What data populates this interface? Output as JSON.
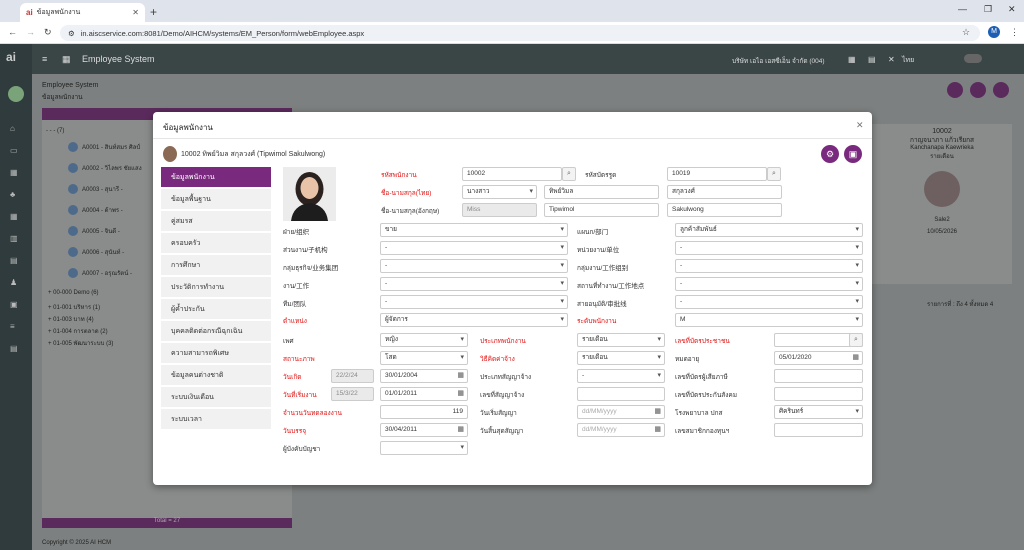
{
  "browser": {
    "tab_title": "ข้อมูลพนักงาน",
    "url": "in.aiscservice.com:8081/Demo/AIHCM/systems/EM_Person/form/webEmployee.aspx",
    "profile_initial": "M"
  },
  "app": {
    "title": "Employee System",
    "breadcrumb_top": "Employee System",
    "breadcrumb_sub": "ข้อมูลพนักงาน",
    "company_text": "บริษัท เอไอ เอสซีเอ็น จำกัด (004)",
    "lang": "ไทย",
    "tree_items": [
      "A0001 - สินท์สมร ศิลป์",
      "A0002 - วิไลพร ชัยแสง",
      "A0003 - สุนารี -",
      "A0004 - ด้าพร -",
      "A0005 - จินดี -",
      "A0006 - สุนันท์ -",
      "A0007 - อรุณรัตน์ -"
    ],
    "tree_groups": [
      "00-000 Demo (6)",
      "01-001 บริหาร (1)",
      "01-003 บาท (4)",
      "01-004 การตลาด (2)",
      "01-005 พัฒนาระบบ (3)"
    ],
    "tree_root": "- - - (7)",
    "card_code": "10002",
    "card_name": "กาญจนาภา แก้วเรียกส",
    "card_name_en": "Kanchanapa Kaewrieka",
    "card_role": "รายเดือน",
    "card_status": "Sale2",
    "card_date": "10/05/2026",
    "pager_text": "รายการที่ : ถึง 4 ทั้งหมด 4",
    "footer_total": "Total = 27",
    "copyright": "Copyright © 2025 AI HCM"
  },
  "modal": {
    "title": "ข้อมูลพนักงาน",
    "employee_header": "10002 ทิพย์วิมล สกุลวงศ์ (Tipwimol Sakulwong)",
    "menu": [
      {
        "label": "ข้อมูลพนักงาน",
        "active": true
      },
      {
        "label": "ข้อมูลพื้นฐาน",
        "active": false
      },
      {
        "label": "คู่สมรส",
        "active": false
      },
      {
        "label": "ครอบครัว",
        "active": false
      },
      {
        "label": "การศึกษา",
        "active": false
      },
      {
        "label": "ประวัติการทำงาน",
        "active": false
      },
      {
        "label": "ผู้ค้ำประกัน",
        "active": false
      },
      {
        "label": "บุคคลติดต่อกรณีฉุกเฉิน",
        "active": false
      },
      {
        "label": "ความสามารถพิเศษ",
        "active": false
      },
      {
        "label": "ข้อมูลคนต่างชาติ",
        "active": false
      },
      {
        "label": "ระบบเงินเดือน",
        "active": false
      },
      {
        "label": "ระบบเวลา",
        "active": false
      }
    ],
    "fields": {
      "emp_code_label": "รหัสพนักงาน",
      "emp_code": "10002",
      "card_code_label": "รหัสบัตรรูด",
      "card_code": "10019",
      "name_th_label": "ชื่อ-นามสกุล(ไทย)",
      "prefix_th": "นางสาว",
      "first_th": "ทิพย์วิมล",
      "last_th": "สกุลวงศ์",
      "name_en_label": "ชื่อ-นามสกุล(อังกฤษ)",
      "prefix_en": "Miss",
      "first_en": "Tipwimol",
      "last_en": "Sakulwong",
      "division_label": "ฝ่าย/组织",
      "division": "ขาย",
      "dept_label": "แผนก/部门",
      "dept": "ลูกค้าสัมพันธ์",
      "section_label": "ส่วนงาน/子机构",
      "section": "-",
      "unit_label": "หน่วยงาน/单位",
      "unit": "-",
      "bgroup_label": "กลุ่มธุรกิจ/业务集团",
      "bgroup": "-",
      "wgroup_label": "กลุ่มงาน/工作组别",
      "wgroup": "-",
      "job_label": "งาน/工作",
      "job": "-",
      "workplace_label": "สถานที่ทำงาน/工作地点",
      "workplace": "-",
      "team_label": "ทีม/团队",
      "team": "-",
      "approver_label": "สายอนุมัติ/审批线",
      "approver": "-",
      "position_label": "ตำแหน่ง",
      "position": "ผู้จัดการ",
      "level_label": "ระดับพนักงาน",
      "level": "M",
      "gender_label": "เพศ",
      "gender": "หญิง",
      "emp_type_label": "ประเภทพนักงาน",
      "emp_type": "รายเดือน",
      "idcard_label": "เลขที่บัตรประชาชน",
      "idcard": "",
      "marital_label": "สถานะภาพ",
      "marital": "โสด",
      "pay_method_label": "วิธีคิดค่าจ้าง",
      "pay_method": "รายเดือน",
      "expire_label": "หมดอายุ",
      "expire": "05/01/2020",
      "birth_label": "วันเกิด",
      "age": "22/2/24",
      "birth": "30/01/2004",
      "contract_type_label": "ประเภทสัญญาจ้าง",
      "contract_type": "-",
      "tax_id_label": "เลขที่บัตรผู้เสียภาษี",
      "tax_id": "",
      "start_label": "วันที่เริ่มงาน",
      "service": "15/3/22",
      "start": "01/01/2011",
      "contract_no_label": "เลขที่สัญญาจ้าง",
      "contract_no": "",
      "sso_label": "เลขที่บัตรประกันสังคม",
      "sso": "",
      "probation_label": "จำนวนวันทดลองงาน",
      "probation": "119",
      "contract_start_label": "วันเริ่มสัญญา",
      "contract_start": "dd/MM/yyyy",
      "hospital_label": "โรงพยาบาล ปกส",
      "hospital": "ศิครินทร์",
      "confirm_label": "วันบรรจุ",
      "confirm": "30/04/2011",
      "contract_end_label": "วันสิ้นสุดสัญญา",
      "contract_end": "dd/MM/yyyy",
      "pf_label": "เลขสมาชิกกองทุนฯ",
      "pf": "",
      "supervisor_label": "ผู้บังคับบัญชา",
      "supervisor": ""
    }
  }
}
